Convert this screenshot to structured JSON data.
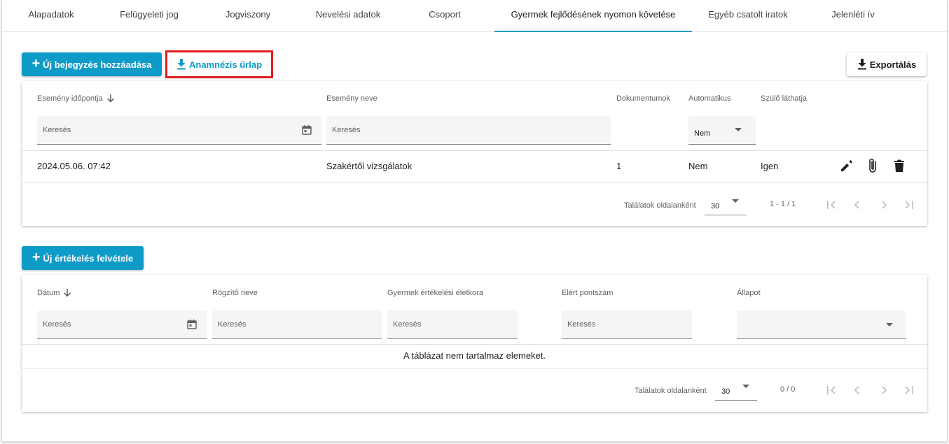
{
  "tabs": [
    {
      "label": "Alapadatok"
    },
    {
      "label": "Felügyeleti jog"
    },
    {
      "label": "Jogviszony"
    },
    {
      "label": "Nevelési adatok"
    },
    {
      "label": "Csoport"
    },
    {
      "label": "Gyermek fejlődésének nyomon követése"
    },
    {
      "label": "Egyéb csatolt iratok"
    },
    {
      "label": "Jelenléti ív"
    }
  ],
  "active_tab": "Gyermek fejlődésének nyomon követése",
  "toolbar": {
    "add_entry_label": "Új bejegyzés hozzáadása",
    "anamnesis_label": "Anamnézis űrlap",
    "export_label": "Exportálás"
  },
  "events_table": {
    "headers": {
      "date": "Esemény időpontja",
      "name": "Esemény neve",
      "documents": "Dokumentumok",
      "automatic": "Automatikus",
      "parent_visible": "Szülő láthatja"
    },
    "filters": {
      "date_placeholder": "Keresés",
      "name_placeholder": "Keresés",
      "automatic_value": "Nem"
    },
    "rows": [
      {
        "date": "2024.05.06. 07:42",
        "name": "Szakértői vizsgálatok",
        "documents": "1",
        "automatic": "Nem",
        "parent_visible": "Igen"
      }
    ],
    "paginator": {
      "label": "Találatok oldalanként",
      "page_size": "30",
      "range": "1 - 1 / 1"
    }
  },
  "evaluation": {
    "add_label": "Új értékelés felvétele"
  },
  "evaluations_table": {
    "headers": {
      "date": "Dátum",
      "recorder": "Rögzítő neve",
      "age": "Gyermek értékelési életkora",
      "score": "Elért pontszám",
      "status": "Állapot"
    },
    "filters": {
      "date_placeholder": "Keresés",
      "recorder_placeholder": "Keresés",
      "age_placeholder": "Keresés",
      "score_placeholder": "Keresés",
      "status_value": ""
    },
    "empty_message": "A táblázat nem tartalmaz elemeket.",
    "paginator": {
      "label": "Találatok oldalanként",
      "page_size": "30",
      "range": "0 / 0"
    }
  },
  "colors": {
    "primary": "#0f9bc7",
    "highlight_border": "#e01b22",
    "active_tab_underline": "#1e9bc6"
  }
}
